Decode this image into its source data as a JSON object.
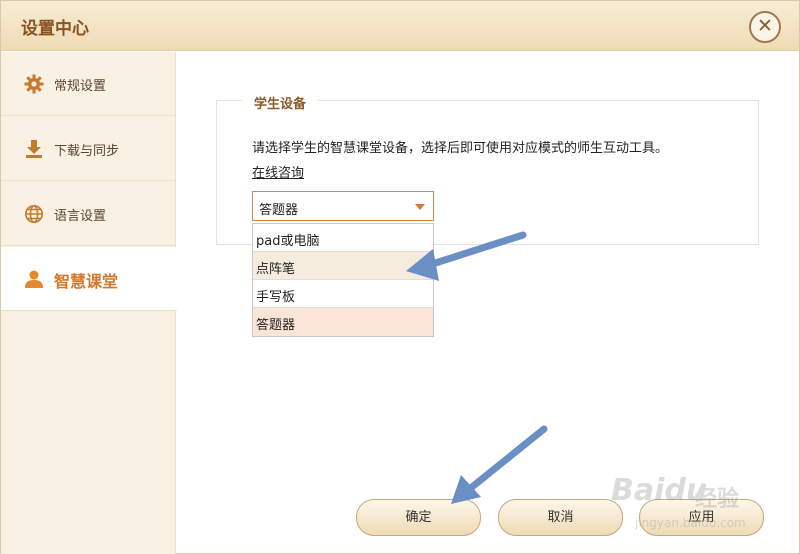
{
  "window": {
    "title": "设置中心"
  },
  "icons": {
    "close": "close-icon",
    "general": "gear-icon",
    "download": "download-icon",
    "language": "globe-icon",
    "classroom": "user-icon"
  },
  "sidebar": {
    "items": [
      {
        "label": "常规设置",
        "active": false
      },
      {
        "label": "下载与同步",
        "active": false
      },
      {
        "label": "语言设置",
        "active": false
      },
      {
        "label": "智慧课堂",
        "active": true
      }
    ]
  },
  "section": {
    "title": "学生设备",
    "description": "请选择学生的智慧课堂设备，选择后即可使用对应模式的师生互动工具。",
    "link": "在线咨询"
  },
  "device_select": {
    "value": "答题器",
    "options": [
      "pad或电脑",
      "点阵笔",
      "手写板",
      "答题器"
    ],
    "hovered": "点阵笔"
  },
  "footer": {
    "ok_label": "确定",
    "cancel_label": "取消",
    "apply_label": "应用"
  },
  "watermark": {
    "brand": "Baidu",
    "brand_cn": "经验",
    "url": "jingyan.baidu.com"
  },
  "colors": {
    "accent": "#d2782a",
    "arrow": "#6a8fc4",
    "title_bg": "#f2e3c4"
  }
}
